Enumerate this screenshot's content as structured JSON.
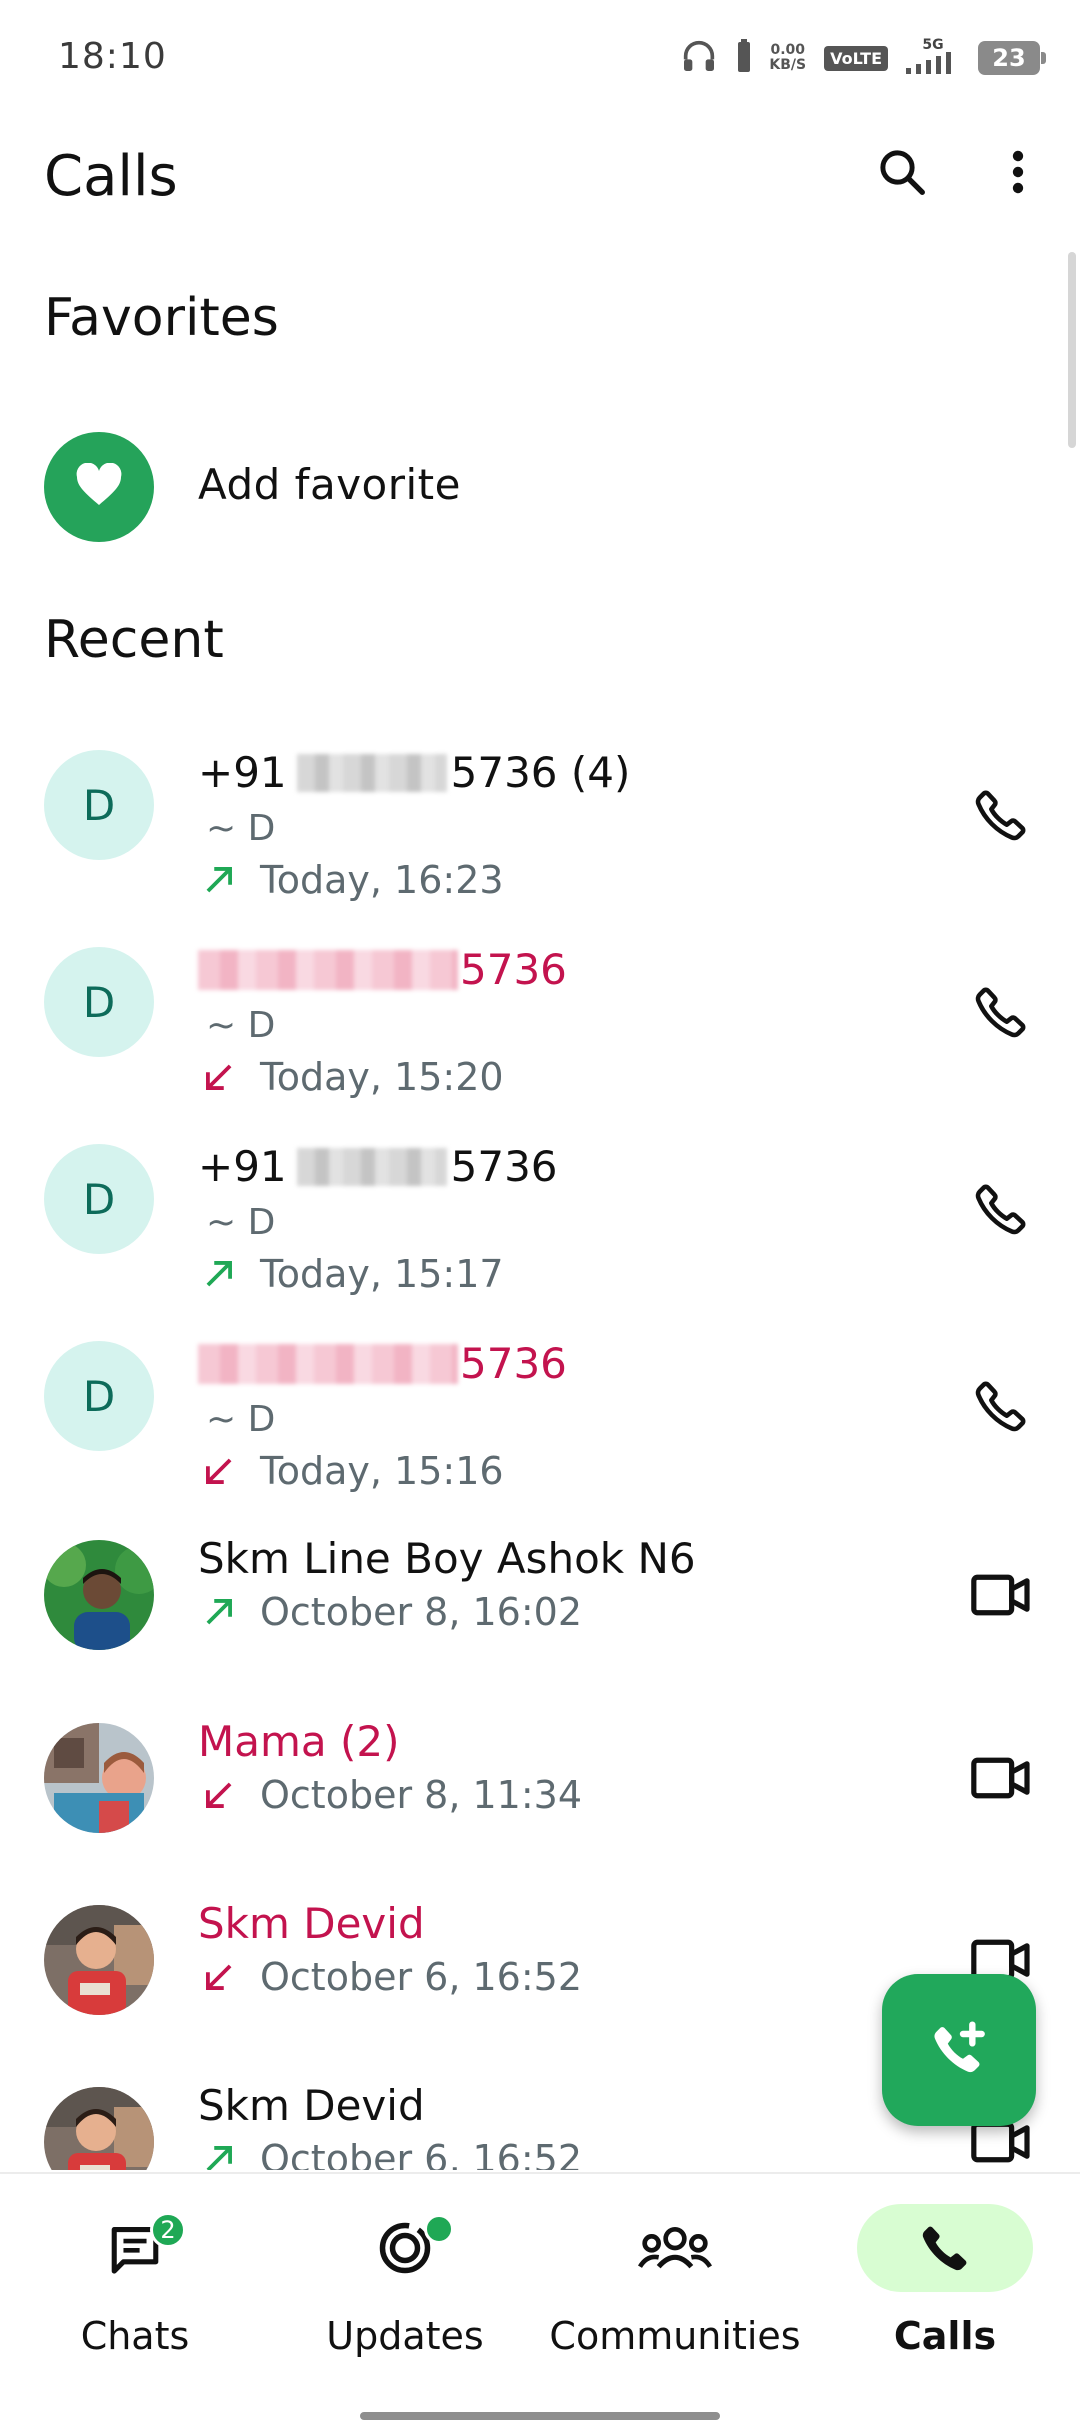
{
  "status_bar": {
    "time": "18:10",
    "net_speed_value": "0.00",
    "net_speed_unit": "KB/S",
    "volte": "VoLTE",
    "network": "5G",
    "battery": "23"
  },
  "app_bar": {
    "title": "Calls",
    "search_icon": "search-icon",
    "menu_icon": "more-vert-icon"
  },
  "favorites": {
    "title": "Favorites",
    "add_label": "Add favorite"
  },
  "recent": {
    "title": "Recent",
    "calls": [
      {
        "name_prefix": "+91",
        "name_suffix": "5736 (4)",
        "sub": "~ D",
        "time": "Today, 16:23",
        "direction": "outgoing",
        "type": "voice",
        "missed": false,
        "avatar_letter": "D"
      },
      {
        "name_prefix": "",
        "name_suffix": "5736",
        "sub": "~ D",
        "time": "Today, 15:20",
        "direction": "incoming",
        "type": "voice",
        "missed": true,
        "avatar_letter": "D"
      },
      {
        "name_prefix": "+91",
        "name_suffix": "5736",
        "sub": "~ D",
        "time": "Today, 15:17",
        "direction": "outgoing",
        "type": "voice",
        "missed": false,
        "avatar_letter": "D"
      },
      {
        "name_prefix": "",
        "name_suffix": "5736",
        "sub": "~ D",
        "time": "Today, 15:16",
        "direction": "incoming",
        "type": "voice",
        "missed": true,
        "avatar_letter": "D"
      },
      {
        "name": "Skm Line Boy Ashok N6",
        "time": "October 8, 16:02",
        "direction": "outgoing",
        "type": "video",
        "missed": false
      },
      {
        "name": "Mama (2)",
        "time": "October 8, 11:34",
        "direction": "incoming",
        "type": "video",
        "missed": true
      },
      {
        "name": "Skm Devid",
        "time": "October 6, 16:52",
        "direction": "incoming",
        "type": "video",
        "missed": true
      },
      {
        "name": "Skm Devid",
        "time": "October 6, 16:52",
        "direction": "outgoing",
        "type": "video",
        "missed": false
      }
    ]
  },
  "fab": {
    "icon": "add-call-icon"
  },
  "bottom_nav": {
    "items": [
      {
        "label": "Chats",
        "icon": "chats-icon",
        "badge": "2",
        "active": false
      },
      {
        "label": "Updates",
        "icon": "updates-icon",
        "dot": true,
        "active": false
      },
      {
        "label": "Communities",
        "icon": "communities-icon",
        "active": false
      },
      {
        "label": "Calls",
        "icon": "calls-icon",
        "active": true
      }
    ]
  },
  "colors": {
    "accent_green": "#21a85b",
    "missed_red": "#c3134e",
    "outgoing_green": "#1fa855",
    "active_pill": "#d8fdd2",
    "avatar_bg": "#d5f3ee"
  }
}
